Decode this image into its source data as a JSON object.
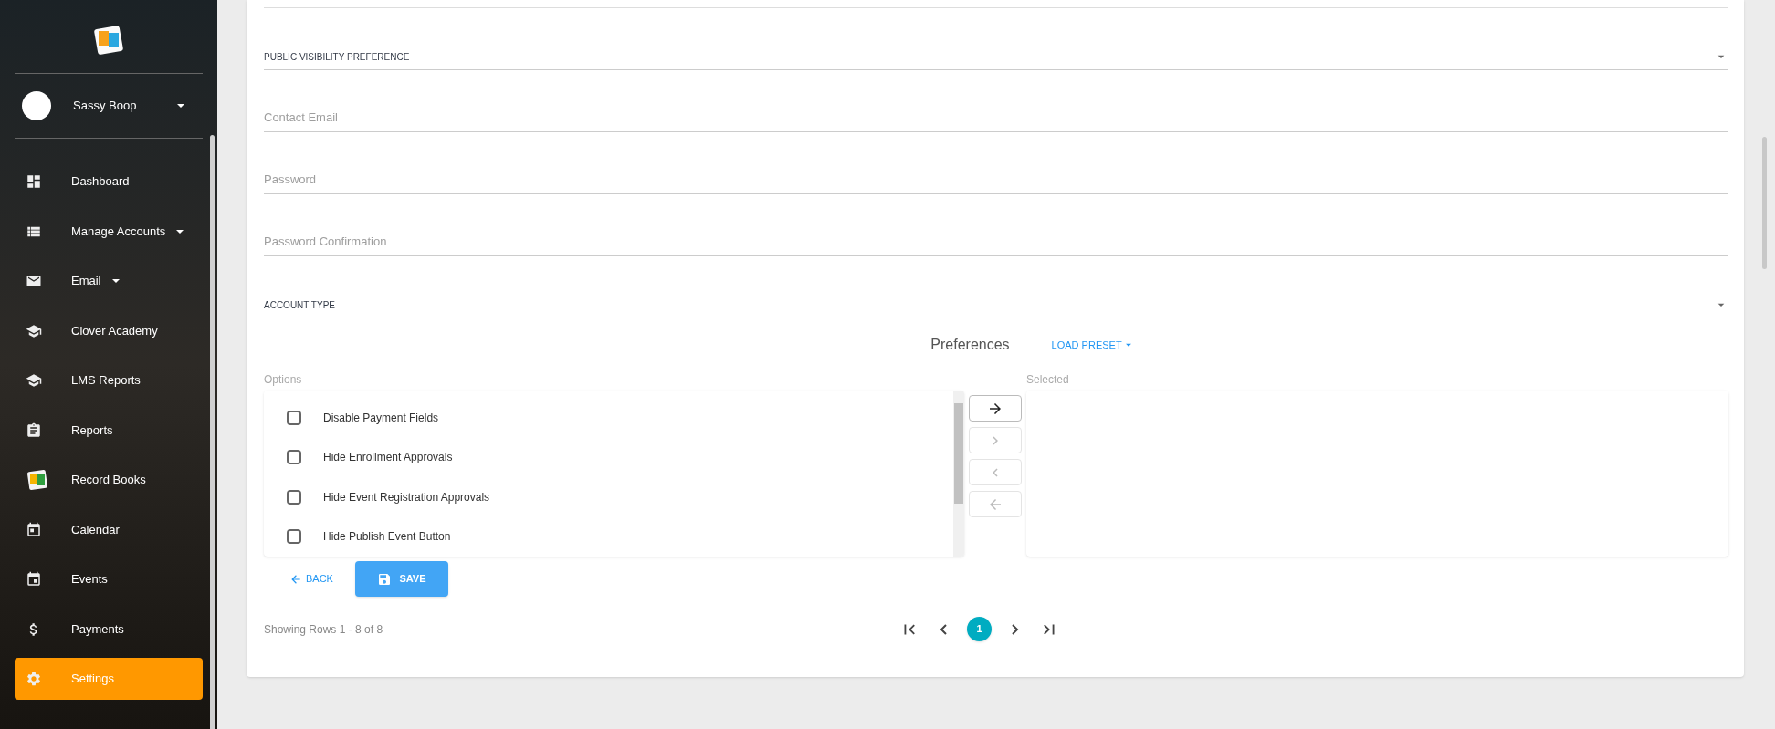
{
  "sidebar": {
    "user": {
      "name": "Sassy Boop"
    },
    "items": [
      {
        "label": "Dashboard",
        "expandable": false,
        "selected": false
      },
      {
        "label": "Manage Accounts",
        "expandable": true,
        "selected": false
      },
      {
        "label": "Email",
        "expandable": true,
        "selected": false
      },
      {
        "label": "Clover Academy",
        "expandable": false,
        "selected": false
      },
      {
        "label": "LMS Reports",
        "expandable": false,
        "selected": false
      },
      {
        "label": "Reports",
        "expandable": false,
        "selected": false
      },
      {
        "label": "Record Books",
        "expandable": false,
        "selected": false
      },
      {
        "label": "Calendar",
        "expandable": false,
        "selected": false
      },
      {
        "label": "Events",
        "expandable": false,
        "selected": false
      },
      {
        "label": "Payments",
        "expandable": false,
        "selected": false
      },
      {
        "label": "Settings",
        "expandable": false,
        "selected": true
      }
    ]
  },
  "form": {
    "fields": [
      {
        "kind": "select",
        "label": "PUBLIC VISIBILITY PREFERENCE"
      },
      {
        "kind": "text",
        "placeholder": "Contact Email"
      },
      {
        "kind": "text",
        "placeholder": "Password"
      },
      {
        "kind": "text",
        "placeholder": "Password Confirmation"
      },
      {
        "kind": "select",
        "label": "ACCOUNT TYPE"
      }
    ]
  },
  "preferences": {
    "title": "Preferences",
    "preset_button": "LOAD PRESET",
    "options_label": "Options",
    "selected_label": "Selected",
    "options": [
      {
        "label": "Disable Payment Fields",
        "checked": false
      },
      {
        "label": "Hide Enrollment Approvals",
        "checked": false
      },
      {
        "label": "Hide Event Registration Approvals",
        "checked": false
      },
      {
        "label": "Hide Publish Event Button",
        "checked": false
      }
    ],
    "transfer_buttons": [
      {
        "kind": "all-right",
        "disabled": false
      },
      {
        "kind": "right",
        "disabled": true
      },
      {
        "kind": "left",
        "disabled": true
      },
      {
        "kind": "all-left",
        "disabled": true
      }
    ]
  },
  "actions": {
    "back": "BACK",
    "save": "SAVE"
  },
  "pagination": {
    "summary": "Showing Rows 1 - 8 of 8",
    "pages": [
      {
        "label": "1",
        "selected": true
      }
    ]
  }
}
